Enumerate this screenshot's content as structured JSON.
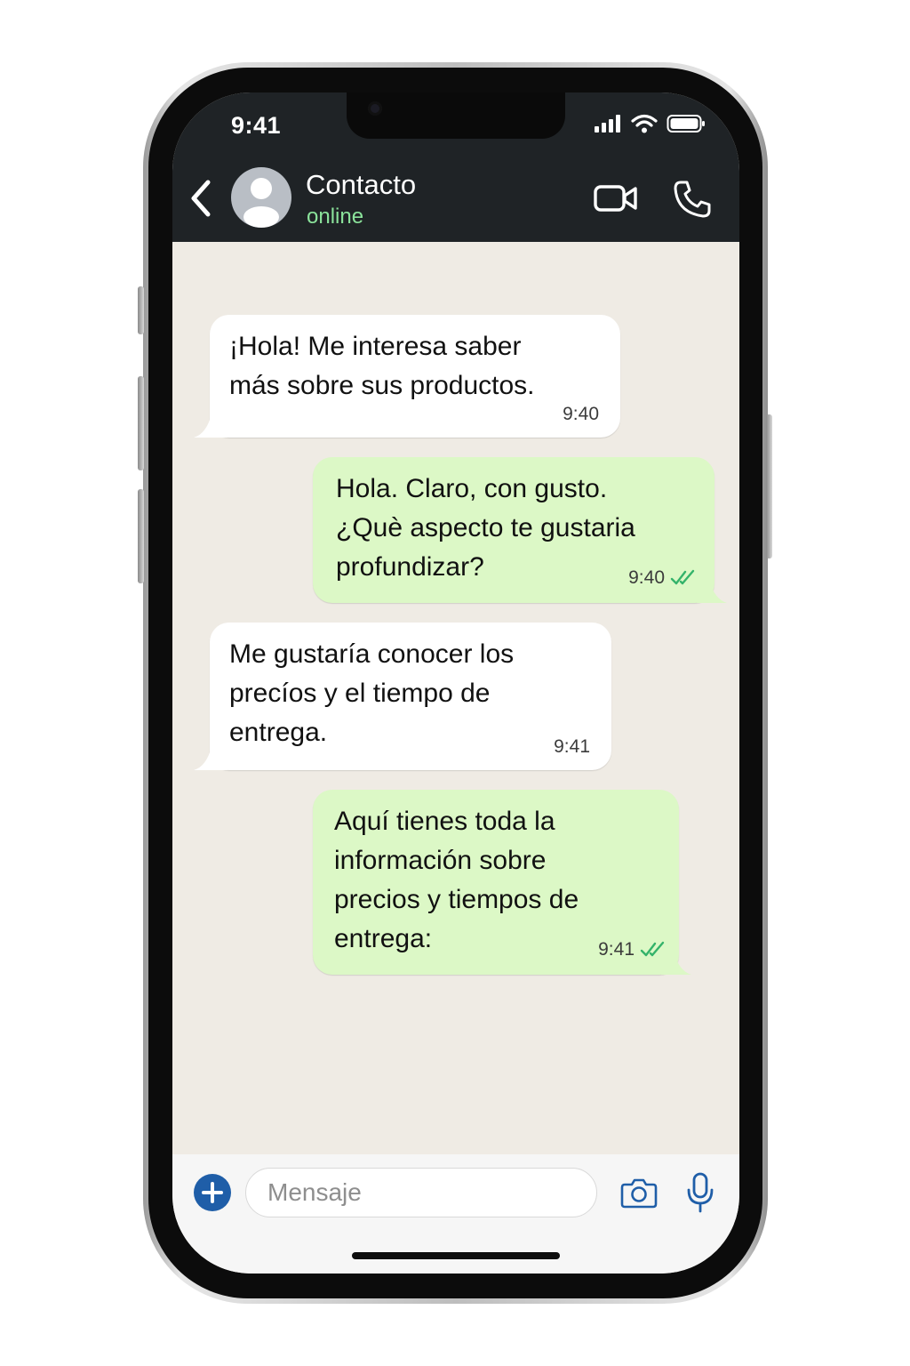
{
  "status_bar": {
    "time": "9:41"
  },
  "header": {
    "contact_name": "Contacto",
    "contact_status": "online",
    "status_color": "#8be39b",
    "icons": [
      "chevron-left-icon",
      "avatar-person-icon",
      "video-camera-icon",
      "phone-icon"
    ]
  },
  "messages": [
    {
      "direction": "incoming",
      "text": "¡Hola! Me interesa saber\nmás sobre sus productos.",
      "time": "9:40"
    },
    {
      "direction": "outgoing",
      "text": "Hola. Claro, con gusto.\n¿Què aspecto te gustaria\nprofundizar?",
      "time": "9:40",
      "read_receipt": "double-check-icon"
    },
    {
      "direction": "incoming",
      "text": "Me gustaría conocer los\nprecíos y el tiempo de\nentrega.",
      "time": "9:41"
    },
    {
      "direction": "outgoing",
      "text": "Aquí tienes toda la\ninformación sobre\nprecios y tiempos de\nentrega:",
      "time": "9:41",
      "read_receipt": "double-check-icon"
    }
  ],
  "composer": {
    "placeholder": "Mensaje",
    "icons": [
      "plus-icon",
      "camera-icon",
      "microphone-icon"
    ]
  },
  "colors": {
    "header_bg": "#1f2326",
    "chat_bg": "#efebe4",
    "incoming_bubble": "#ffffff",
    "outgoing_bubble": "#dcf8c6",
    "read_tick": "#34b36a",
    "accent_blue": "#1f5ea8"
  }
}
